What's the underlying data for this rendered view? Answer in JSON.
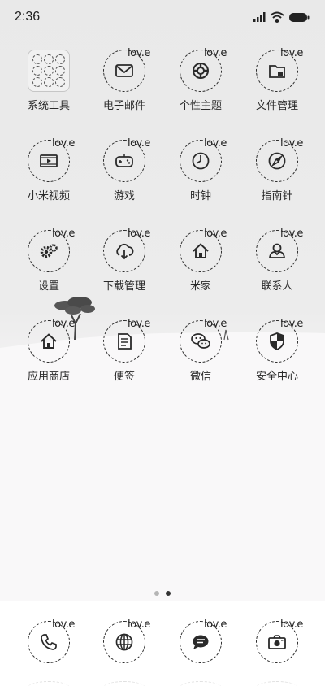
{
  "status_bar": {
    "time": "2:36"
  },
  "badge_text": "lov.e",
  "apps": [
    {
      "label": "系统工具",
      "icon": "folder-icon"
    },
    {
      "label": "电子邮件",
      "icon": "mail-icon"
    },
    {
      "label": "个性主题",
      "icon": "theme-icon"
    },
    {
      "label": "文件管理",
      "icon": "folder-file-icon"
    },
    {
      "label": "小米视频",
      "icon": "video-icon"
    },
    {
      "label": "游戏",
      "icon": "gamepad-icon"
    },
    {
      "label": "时钟",
      "icon": "clock-icon"
    },
    {
      "label": "指南针",
      "icon": "compass-icon"
    },
    {
      "label": "设置",
      "icon": "gear-icon"
    },
    {
      "label": "下载管理",
      "icon": "cloud-download-icon"
    },
    {
      "label": "米家",
      "icon": "home-icon"
    },
    {
      "label": "联系人",
      "icon": "contact-icon"
    },
    {
      "label": "应用商店",
      "icon": "store-home-icon"
    },
    {
      "label": "便签",
      "icon": "note-icon"
    },
    {
      "label": "微信",
      "icon": "wechat-icon"
    },
    {
      "label": "安全中心",
      "icon": "shield-icon"
    }
  ],
  "dock": [
    {
      "icon": "phone-icon"
    },
    {
      "icon": "globe-icon"
    },
    {
      "icon": "message-icon"
    },
    {
      "icon": "camera-icon"
    }
  ],
  "page_indicator": {
    "pages": 2,
    "current": 2
  },
  "colors": {
    "icon_stroke": "#2a2a2a",
    "dot_active": "#333333",
    "dot_inactive": "#b5b5b5"
  }
}
